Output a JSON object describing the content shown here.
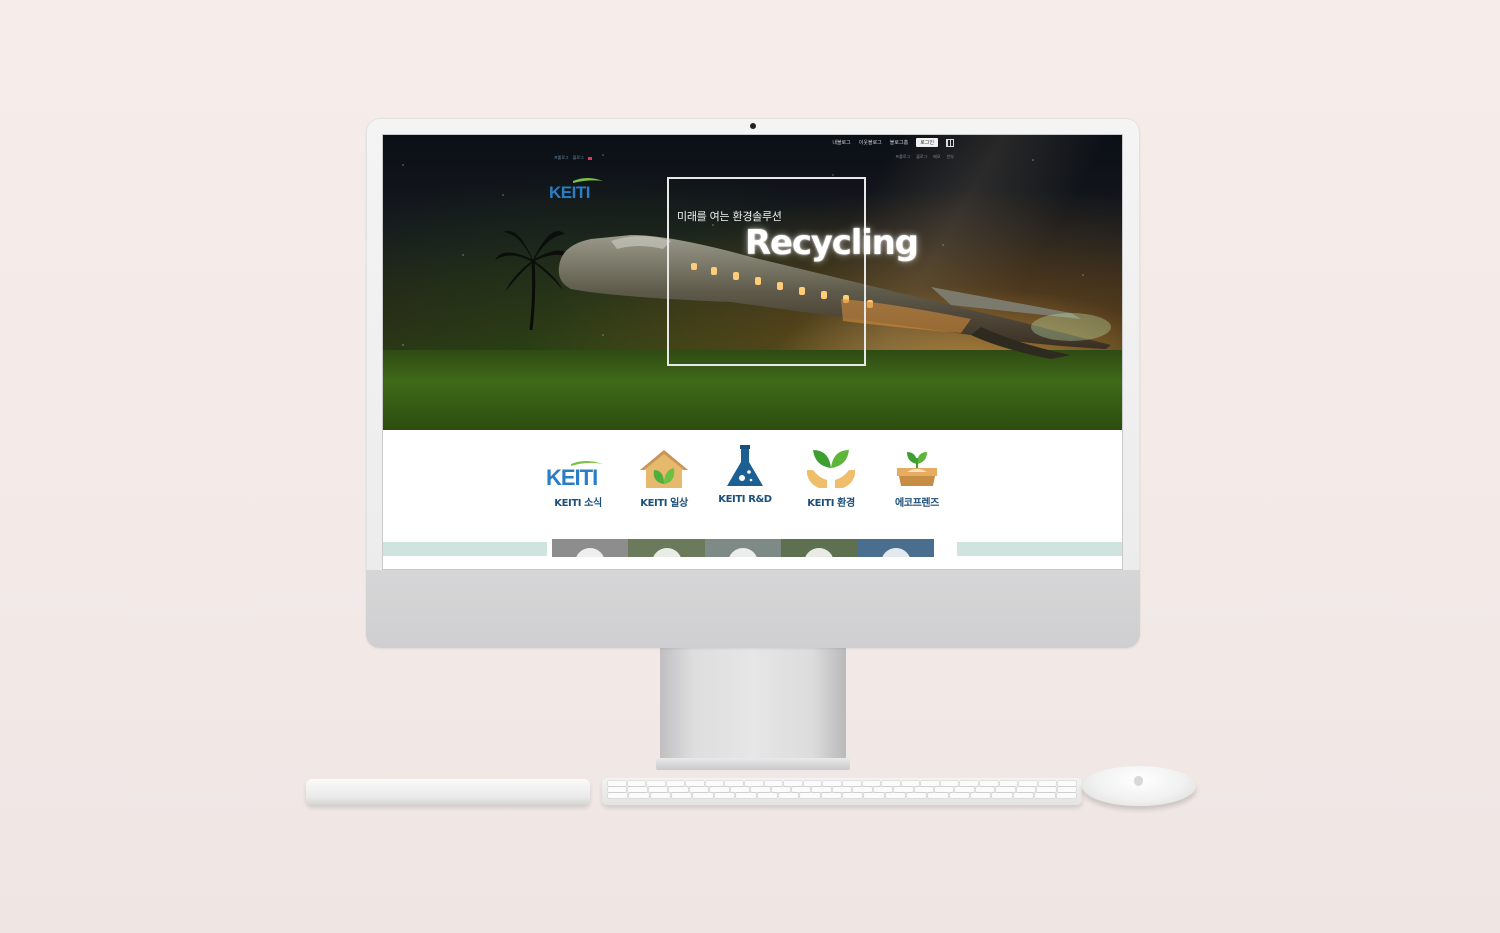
{
  "site": {
    "top_links": [
      "내블로그",
      "이웃블로그",
      "블로그홈"
    ],
    "login_label": "로그인",
    "sub_links": [
      "프롤로그",
      "블로그",
      "메모",
      "안부"
    ],
    "lang_links": [
      "프롤로그",
      "블로그"
    ],
    "logo_text": "KEITI"
  },
  "hero": {
    "subtitle": "미래를 여는 환경솔루션",
    "title": "Recycling"
  },
  "categories": [
    {
      "label": "KEITI 소식",
      "icon": "keiti-logo-icon"
    },
    {
      "label": "KEITI 일상",
      "icon": "house-leaf-icon"
    },
    {
      "label": "KEITI R&D",
      "icon": "flask-icon"
    },
    {
      "label": "KEITI 환경",
      "icon": "hands-sprout-icon"
    },
    {
      "label": "에코프렌즈",
      "icon": "pot-sprout-icon"
    }
  ],
  "colors": {
    "brand_blue": "#1a6fb8",
    "brand_green": "#6bb43a",
    "label_navy": "#1c4f7a",
    "mint_strip": "#cfe3df"
  }
}
